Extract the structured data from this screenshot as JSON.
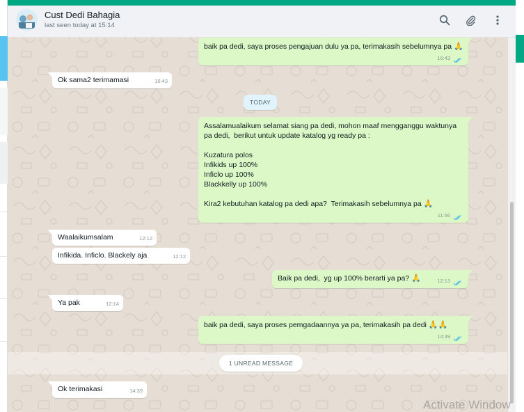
{
  "header": {
    "contact_name": "Cust Dedi Bahagia",
    "status": "last seen today at 15:14",
    "icons": [
      "search-icon",
      "paperclip-icon",
      "more-vertical-icon"
    ]
  },
  "messages": [
    {
      "dir": "out",
      "lines": [
        "baik pa dedi, saya proses pengajuan dulu ya pa, terimakasih sebelumnya pa"
      ],
      "emoji": "🙏",
      "time": "16:43",
      "ticks": "read"
    },
    {
      "dir": "in",
      "lines": [
        "Ok sama2 terimamasi"
      ],
      "time": "16:43"
    },
    {
      "dir": "out",
      "lines": [
        "Assalamualaikum selamat siang pa dedi, mohon maaf mengganggu waktunya",
        "pa dedi,  berikut untuk update katalog yg ready pa :",
        "",
        "Kuzatura polos",
        "Infikids up 100%",
        "Inficlo up 100%",
        "Blackkelly up 100%",
        "",
        "Kira2 kebutuhan katalog pa dedi apa?  Terimakasih sebelumnya pa"
      ],
      "emoji": "🙏",
      "time": "11:56",
      "ticks": "read"
    },
    {
      "dir": "in",
      "lines": [
        "Waalaikumsalam"
      ],
      "time": "12:12"
    },
    {
      "dir": "in",
      "lines": [
        "Infikida. Inficlo. Blackely aja"
      ],
      "time": "12:12"
    },
    {
      "dir": "out",
      "lines": [
        "Baik pa dedi,  yg up 100% berarti ya pa?"
      ],
      "emoji": "🙏",
      "time": "12:13",
      "ticks": "read"
    },
    {
      "dir": "in",
      "lines": [
        "Ya pak"
      ],
      "time": "12:14"
    },
    {
      "dir": "out",
      "lines": [
        "baik pa dedi, saya proses pemgadaannya ya pa, terimakasih pa dedi"
      ],
      "emoji": "🙏🙏",
      "time": "14:39",
      "ticks": "read"
    },
    {
      "dir": "in",
      "lines": [
        "Ok terimakasi"
      ],
      "time": "14:39"
    }
  ],
  "date_divider": "TODAY",
  "unread_divider": "1 UNREAD MESSAGE",
  "watermark": "Activate Window",
  "colors": {
    "outgoing_bubble": "#dcf8c6",
    "incoming_bubble": "#ffffff",
    "chat_background": "#e6ded5",
    "header_background": "#f0f2f5",
    "read_ticks": "#53bdeb",
    "accent": "#00a884"
  }
}
